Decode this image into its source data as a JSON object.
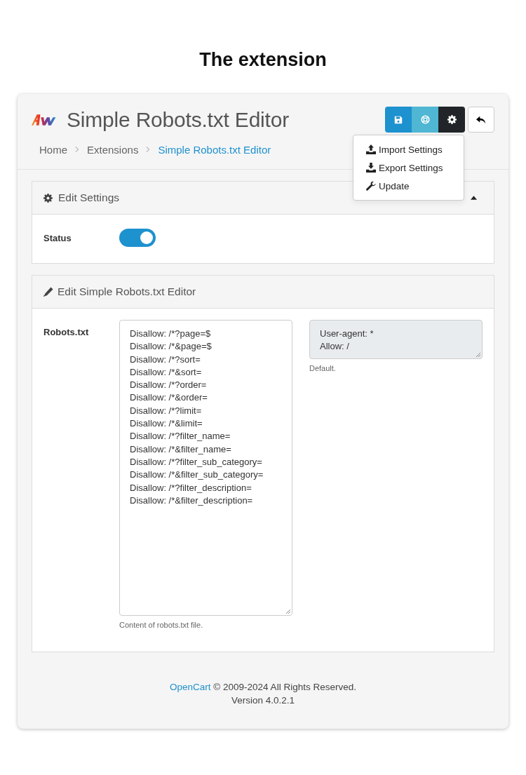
{
  "page_heading": "The extension",
  "header": {
    "title": "Simple Robots.txt Editor",
    "buttons": [
      {
        "kind": "save"
      },
      {
        "kind": "support"
      },
      {
        "kind": "settings"
      },
      {
        "kind": "back"
      }
    ],
    "breadcrumb": [
      {
        "label": "Home",
        "selected": false
      },
      {
        "label": "Extensions",
        "selected": false
      },
      {
        "label": "Simple Robots.txt Editor",
        "selected": true
      }
    ],
    "dropdown": [
      {
        "kind": "import",
        "label": "Import Settings"
      },
      {
        "kind": "export",
        "label": "Export Settings"
      },
      {
        "kind": "update",
        "label": "Update"
      }
    ]
  },
  "settings_panel": {
    "title": "Edit Settings",
    "expanded": true,
    "status": {
      "label": "Status",
      "on": true
    }
  },
  "editor_panel": {
    "title": "Edit Simple Robots.txt Editor",
    "field_label": "Robots.txt",
    "robots_lines": [
      "Disallow: /*?page=$",
      "Disallow: /*&page=$",
      "Disallow: /*?sort=",
      "Disallow: /*&sort=",
      "Disallow: /*?order=",
      "Disallow: /*&order=",
      "Disallow: /*?limit=",
      "Disallow: /*&limit=",
      "Disallow: /*?filter_name=",
      "Disallow: /*&filter_name=",
      "Disallow: /*?filter_sub_category=",
      "Disallow: /*&filter_sub_category=",
      "Disallow: /*?filter_description=",
      "Disallow: /*&filter_description="
    ],
    "robots_help": "Content of robots.txt file.",
    "default_lines": [
      "User-agent: *",
      "Allow: /"
    ],
    "default_help": "Default."
  },
  "footer": {
    "link": "OpenCart",
    "copyright": "© 2009-2024 All Rights Reserved.",
    "version": "Version 4.0.2.1"
  }
}
